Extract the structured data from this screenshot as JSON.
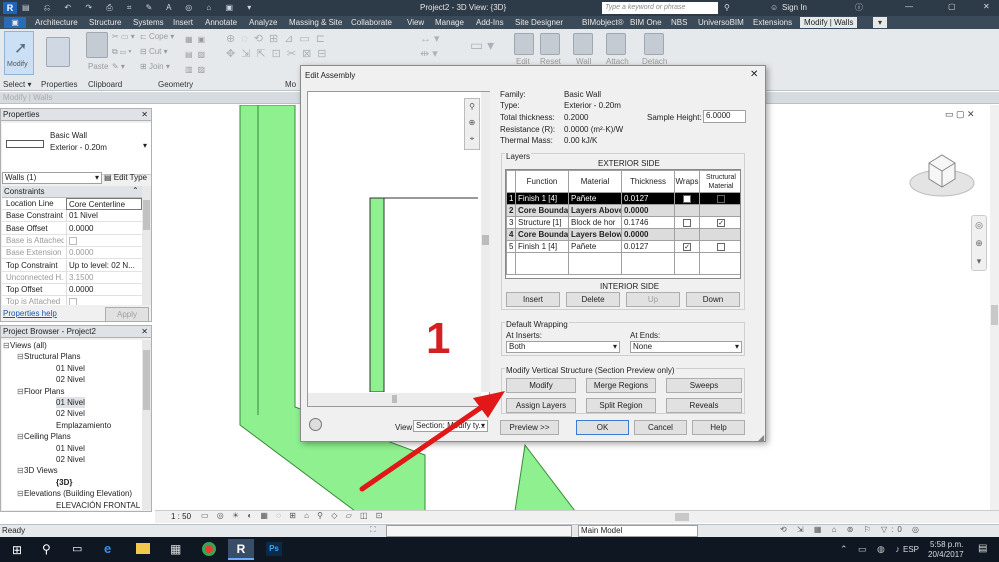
{
  "window": {
    "title": "Project2 - 3D View: {3D}",
    "search_placeholder": "Type a keyword or phrase",
    "sign_in": "Sign In"
  },
  "tabs": [
    "Architecture",
    "Structure",
    "Systems",
    "Insert",
    "Annotate",
    "Analyze",
    "Massing & Site",
    "Collaborate",
    "View",
    "Manage",
    "Add-Ins",
    "Site Designer",
    "BIMobject®",
    "BIM One",
    "NBS",
    "UniversoBIM",
    "Extensions",
    "Modify | Walls"
  ],
  "ribbon": {
    "modify": "Modify",
    "select": "Select ▾",
    "properties": "Properties",
    "clipboard": "Clipboard",
    "geometry": "Geometry",
    "paste": "Paste",
    "cope": "Cope",
    "cut": "Cut",
    "join": "Join",
    "edit_assembly": "Edit",
    "reset": "Reset",
    "wall": "Wall",
    "attach": "Attach",
    "detach": "Detach",
    "mo": "Mo"
  },
  "context_bar": "Modify | Walls",
  "properties": {
    "header": "Properties",
    "type_name": "Basic Wall",
    "type_sub": "Exterior - 0.20m",
    "instance_sel": "Walls (1)",
    "edit_type": "Edit Type",
    "category": "Constraints",
    "rows": [
      {
        "k": "Location Line",
        "v": "Core Centerline"
      },
      {
        "k": "Base Constraint",
        "v": "01 Nivel"
      },
      {
        "k": "Base Offset",
        "v": "0.0000"
      },
      {
        "k": "Base is Attached",
        "v": ""
      },
      {
        "k": "Base Extension ...",
        "v": "0.0000"
      },
      {
        "k": "Top Constraint",
        "v": "Up to level: 02 N..."
      },
      {
        "k": "Unconnected H...",
        "v": "3.1500"
      },
      {
        "k": "Top Offset",
        "v": "0.0000"
      },
      {
        "k": "Top is Attached",
        "v": ""
      }
    ],
    "help": "Properties help",
    "apply": "Apply"
  },
  "browser": {
    "header": "Project Browser - Project2",
    "items": [
      "Views (all)",
      "Structural Plans",
      "01 Nivel",
      "02 Nivel",
      "Floor Plans",
      "01 Nivel",
      "02 Nivel",
      "Emplazamiento",
      "Ceiling Plans",
      "01 Nivel",
      "02 Nivel",
      "3D Views",
      "{3D}",
      "Elevations (Building Elevation)",
      "ELEVACIÓN FRONTAL"
    ]
  },
  "dialog": {
    "title": "Edit Assembly",
    "family_k": "Family:",
    "family_v": "Basic Wall",
    "type_k": "Type:",
    "type_v": "Exterior - 0.20m",
    "thick_k": "Total thickness:",
    "thick_v": "0.2000",
    "sample_k": "Sample Height:",
    "sample_v": "6.0000",
    "res_k": "Resistance (R):",
    "res_v": "0.0000 (m²·K)/W",
    "mass_k": "Thermal Mass:",
    "mass_v": "0.00 kJ/K",
    "layers_label": "Layers",
    "exterior": "EXTERIOR SIDE",
    "interior": "INTERIOR SIDE",
    "cols": [
      "Function",
      "Material",
      "Thickness",
      "Wraps",
      "Structural Material"
    ],
    "rows": [
      {
        "n": "1",
        "f": "Finish 1 [4]",
        "m": "Pañete",
        "t": "0.0127"
      },
      {
        "n": "2",
        "f": "Core Boundar",
        "m": "Layers Above",
        "t": "0.0000"
      },
      {
        "n": "3",
        "f": "Structure [1]",
        "m": "Block de hor",
        "t": "0.1746"
      },
      {
        "n": "4",
        "f": "Core Boundar",
        "m": "Layers Below",
        "t": "0.0000"
      },
      {
        "n": "5",
        "f": "Finish 1 [4]",
        "m": "Pañete",
        "t": "0.0127"
      }
    ],
    "insert": "Insert",
    "delete": "Delete",
    "up": "Up",
    "down": "Down",
    "wrap_label": "Default Wrapping",
    "at_inserts": "At Inserts:",
    "at_inserts_v": "Both",
    "at_ends": "At Ends:",
    "at_ends_v": "None",
    "mvs_label": "Modify Vertical Structure (Section Preview only)",
    "modify": "Modify",
    "merge": "Merge Regions",
    "sweeps": "Sweeps",
    "assign": "Assign Layers",
    "split": "Split Region",
    "reveals": "Reveals",
    "view_k": "View:",
    "view_v": "Section: Modify ty...",
    "preview": "Preview >>",
    "ok": "OK",
    "cancel": "Cancel",
    "help": "Help",
    "annotation": "1"
  },
  "status": {
    "ready": "Ready",
    "scale": "1 : 50",
    "model": "Main Model"
  },
  "taskbar": {
    "time": "5:58 p.m.",
    "date": "20/4/2017",
    "lang": "ESP"
  }
}
